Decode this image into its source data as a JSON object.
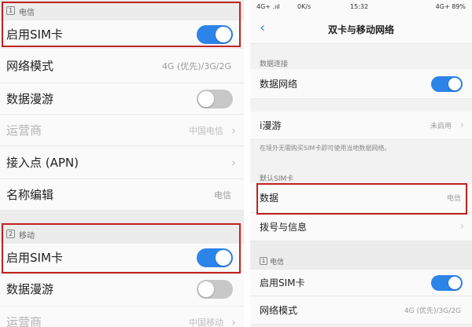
{
  "left": {
    "section1": {
      "num": "1",
      "title": "电信"
    },
    "enable_sim_1": {
      "label": "启用SIM卡",
      "toggle": "on"
    },
    "network_mode": {
      "label": "网络模式",
      "value": "4G (优先)/3G/2G"
    },
    "roaming_1": {
      "label": "数据漫游",
      "toggle": "off"
    },
    "carrier_1": {
      "label": "运营商",
      "value": "中国电信"
    },
    "apn": {
      "label": "接入点 (APN)"
    },
    "name_edit": {
      "label": "名称编辑",
      "value": "电信"
    },
    "section2": {
      "num": "2",
      "title": "移动"
    },
    "enable_sim_2": {
      "label": "启用SIM卡",
      "toggle": "on"
    },
    "roaming_2": {
      "label": "数据漫游",
      "toggle": "off"
    },
    "carrier_2": {
      "label": "运营商",
      "value": "中国移动"
    }
  },
  "right": {
    "status": {
      "signal": "4G+ .ııl",
      "speed": "0K/s",
      "time": "15:32",
      "battery": "4G+ 89%"
    },
    "nav": {
      "back": "‹",
      "title": "双卡与移动网络"
    },
    "data_conn": {
      "heading": "数据连接",
      "label": "数据网络",
      "toggle": "on"
    },
    "i_roaming": {
      "label": "i漫游",
      "value": "未启用",
      "note": "在境外无需购买SIM卡即可使用当地数据网络。"
    },
    "default_sim": {
      "heading": "默认SIM卡"
    },
    "data_row": {
      "label": "数据",
      "value": "电信"
    },
    "dial_row": {
      "label": "拨号与信息"
    },
    "section1": {
      "num": "1",
      "title": "电信"
    },
    "enable_sim": {
      "label": "启用SIM卡",
      "toggle": "on"
    },
    "network_mode": {
      "label": "网络模式",
      "value": "4G (优先)/3G/2G"
    }
  },
  "colors": {
    "accent": "#2d84e8",
    "highlight": "#c0221d",
    "toggle_off": "#c8c8c8"
  }
}
